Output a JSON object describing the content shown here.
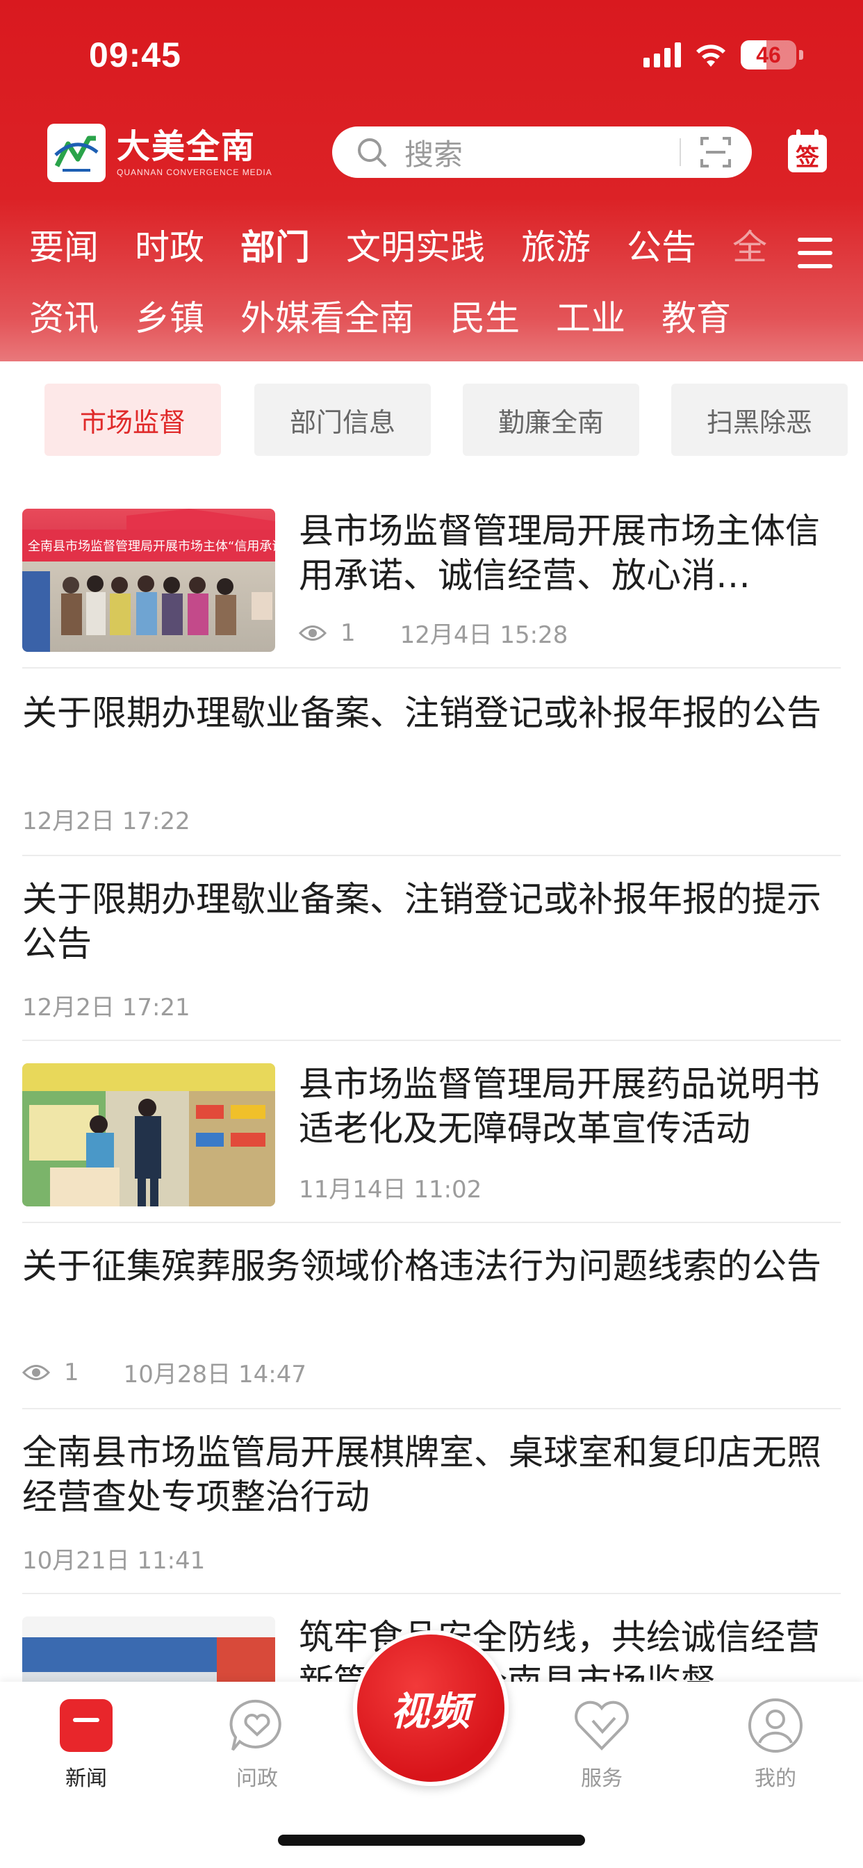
{
  "status": {
    "time": "09:45",
    "battery": "46"
  },
  "header": {
    "logo_title": "大美全南",
    "logo_sub": "QUANNAN CONVERGENCE MEDIA",
    "search_placeholder": "搜索",
    "sign_icon_text": "签"
  },
  "channels": {
    "row1": [
      "要闻",
      "时政",
      "部门",
      "文明实践",
      "旅游",
      "公告",
      "全"
    ],
    "row2": [
      "资讯",
      "乡镇",
      "外媒看全南",
      "民生",
      "工业",
      "教育"
    ],
    "active": "部门"
  },
  "subtabs": [
    {
      "label": "市场监督",
      "active": true
    },
    {
      "label": "部门信息",
      "active": false
    },
    {
      "label": "勤廉全南",
      "active": false
    },
    {
      "label": "扫黑除恶",
      "active": false
    }
  ],
  "news": [
    {
      "title": "县市场监督管理局开展市场主体信用承诺、诚信经营、放心消…",
      "views": "1",
      "date": "12月4日  15:28",
      "has_image": true,
      "banner_text": "全南县市场监督管理局开展市场主体“信用承诺、诚信经营、放心消费”主题宣传活动"
    },
    {
      "title": "关于限期办理歇业备案、注销登记或补报年报的公告",
      "date": "12月2日  17:22"
    },
    {
      "title": "关于限期办理歇业备案、注销登记或补报年报的提示公告",
      "date": "12月2日  17:21"
    },
    {
      "title": "县市场监督管理局开展药品说明书适老化及无障碍改革宣传活动",
      "date": "11月14日  11:02",
      "has_image": true
    },
    {
      "title": "关于征集殡葬服务领域价格违法行为问题线索的公告",
      "views": "1",
      "date": "10月28日  14:47"
    },
    {
      "title": "全南县市场监管局开展棋牌室、桌球室和复印店无照经营查处专项整治行动",
      "date": "10月21日  11:41"
    },
    {
      "title": "筑牢食品安全防线，共绘诚信经营新篇章——全南县市场监督…",
      "has_image": true
    }
  ],
  "tabbar": {
    "news": "新闻",
    "wenzheng": "问政",
    "video": "视频",
    "service": "服务",
    "mine": "我的"
  },
  "colors": {
    "brand_red": "#d9191f",
    "active_tab_bg": "#fde8e8"
  }
}
